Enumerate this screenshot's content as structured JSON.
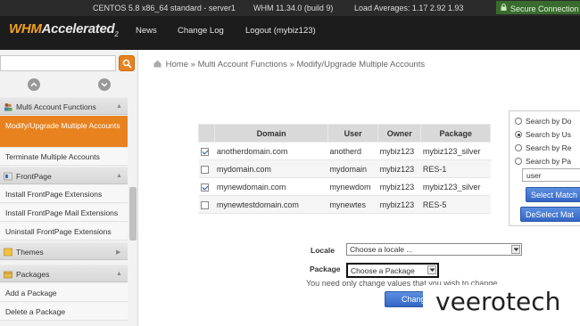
{
  "statusbar": {
    "os": "CENTOS 5.8 x86_64 standard - server1",
    "whm": "WHM 11.34.0 (build 9)",
    "load": "Load Averages: 1.17 2.92 1.93",
    "secure": "Secure Connection"
  },
  "header": {
    "logo_main": "WHM",
    "logo_accel": "Accelerated",
    "logo_sub": "2",
    "nav": [
      "News",
      "Change Log",
      "Logout (mybiz123)"
    ]
  },
  "sidebar": {
    "search_placeholder": "",
    "sections": [
      {
        "label": "Multi Account Functions",
        "icon": "people-icon"
      },
      {
        "label": "FrontPage",
        "icon": "frontpage-icon"
      },
      {
        "label": "Themes",
        "icon": "themes-icon"
      },
      {
        "label": "Packages",
        "icon": "packages-icon"
      }
    ],
    "items": [
      "Modify/Upgrade Multiple Accounts",
      "Terminate Multiple Accounts",
      "Install FrontPage Extensions",
      "Install FrontPage Mail Extensions",
      "Uninstall FrontPage Extensions",
      "Add a Package",
      "Delete a Package"
    ]
  },
  "breadcrumb": {
    "home": "Home",
    "sep": "»",
    "level1": "Multi Account Functions",
    "level2": "Modify/Upgrade Multiple Accounts"
  },
  "table": {
    "headers": [
      "",
      "Domain",
      "User",
      "Owner",
      "Package"
    ],
    "rows": [
      {
        "checked": true,
        "domain": "anotherdomain.com",
        "user": "anotherd",
        "owner": "mybiz123",
        "package": "mybiz123_silver"
      },
      {
        "checked": false,
        "domain": "mydomain.com",
        "user": "mydomain",
        "owner": "mybiz123",
        "package": "RES-1"
      },
      {
        "checked": true,
        "domain": "mynewdomain.com",
        "user": "mynewdom",
        "owner": "mybiz123",
        "package": "mybiz123_silver"
      },
      {
        "checked": false,
        "domain": "mynewtestdomain.com",
        "user": "mynewtes",
        "owner": "mybiz123",
        "package": "RES-5"
      }
    ]
  },
  "search_panel": {
    "options": [
      "Search by Do",
      "Search by Us",
      "Search by Re",
      "Search by Pa"
    ],
    "selected_index": 1,
    "query": "user",
    "select_btn": "Select Match",
    "deselect_btn": "DeSelect Mat"
  },
  "form": {
    "locale_label": "Locale",
    "locale_value": "Choose a locale ...",
    "package_label": "Package",
    "package_value": "Choose a Package",
    "hint": "You need only change values that you wish to change.",
    "submit": "Change"
  },
  "watermark": "veerotech"
}
